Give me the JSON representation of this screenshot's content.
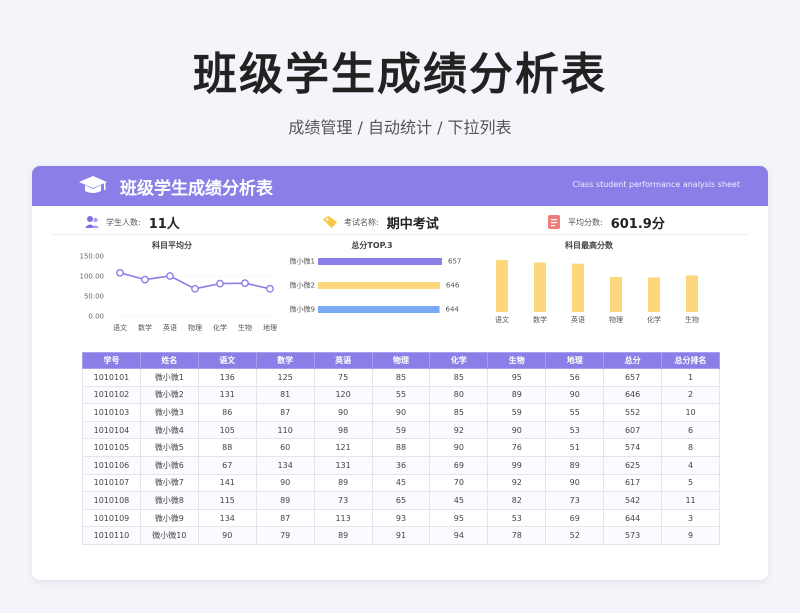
{
  "page": {
    "title": "班级学生成绩分析表",
    "subtitle": "成绩管理 /  自动统计  /  下拉列表"
  },
  "banner": {
    "title": "班级学生成绩分析表",
    "subtitle_en": "Class student performance analysis sheet"
  },
  "info": {
    "students_label": "学生人数:",
    "students_value": "11人",
    "exam_label": "考试名称:",
    "exam_value": "期中考试",
    "avg_label": "平均分数:",
    "avg_value": "601.9分"
  },
  "colors": {
    "accent": "#8a7fe6",
    "yellow": "#fdd77c",
    "blue": "#7aaaf5",
    "purple_bar": "#8a7fe6"
  },
  "chart_data": [
    {
      "type": "line",
      "title": "科目平均分",
      "categories": [
        "语文",
        "数学",
        "英语",
        "物理",
        "化学",
        "生物",
        "地理"
      ],
      "values": [
        108,
        91,
        100,
        68,
        81,
        82,
        68
      ],
      "ylim": [
        0,
        150
      ],
      "yticks": [
        "150.00",
        "100.00",
        "50.00",
        "0.00"
      ],
      "ytick_values": [
        150,
        100,
        50,
        0
      ]
    },
    {
      "type": "bar",
      "orientation": "horizontal",
      "title": "总分TOP.3",
      "categories": [
        "微小微1",
        "微小微2",
        "微小微9"
      ],
      "values": [
        657,
        646,
        644
      ],
      "value_labels": [
        "657",
        "646",
        "644"
      ]
    },
    {
      "type": "bar",
      "title": "科目最高分数",
      "categories": [
        "语文",
        "数学",
        "英语",
        "物理",
        "化学",
        "生物",
        "地理"
      ],
      "values": [
        141,
        134,
        131,
        95,
        94,
        99,
        93
      ]
    }
  ],
  "table": {
    "headers": [
      "学号",
      "姓名",
      "语文",
      "数学",
      "英语",
      "物理",
      "化学",
      "生物",
      "地理",
      "总分",
      "总分排名"
    ],
    "rows": [
      [
        "1010101",
        "微小微1",
        "136",
        "125",
        "75",
        "85",
        "85",
        "95",
        "56",
        "657",
        "1"
      ],
      [
        "1010102",
        "微小微2",
        "131",
        "81",
        "120",
        "55",
        "80",
        "89",
        "90",
        "646",
        "2"
      ],
      [
        "1010103",
        "微小微3",
        "86",
        "87",
        "90",
        "90",
        "85",
        "59",
        "55",
        "552",
        "10"
      ],
      [
        "1010104",
        "微小微4",
        "105",
        "110",
        "98",
        "59",
        "92",
        "90",
        "53",
        "607",
        "6"
      ],
      [
        "1010105",
        "微小微5",
        "88",
        "60",
        "121",
        "88",
        "90",
        "76",
        "51",
        "574",
        "8"
      ],
      [
        "1010106",
        "微小微6",
        "67",
        "134",
        "131",
        "36",
        "69",
        "99",
        "89",
        "625",
        "4"
      ],
      [
        "1010107",
        "微小微7",
        "141",
        "90",
        "89",
        "45",
        "70",
        "92",
        "90",
        "617",
        "5"
      ],
      [
        "1010108",
        "微小微8",
        "115",
        "89",
        "73",
        "65",
        "45",
        "82",
        "73",
        "542",
        "11"
      ],
      [
        "1010109",
        "微小微9",
        "134",
        "87",
        "113",
        "93",
        "95",
        "53",
        "69",
        "644",
        "3"
      ],
      [
        "1010110",
        "微小微10",
        "90",
        "79",
        "89",
        "91",
        "94",
        "78",
        "52",
        "573",
        "9"
      ]
    ]
  }
}
